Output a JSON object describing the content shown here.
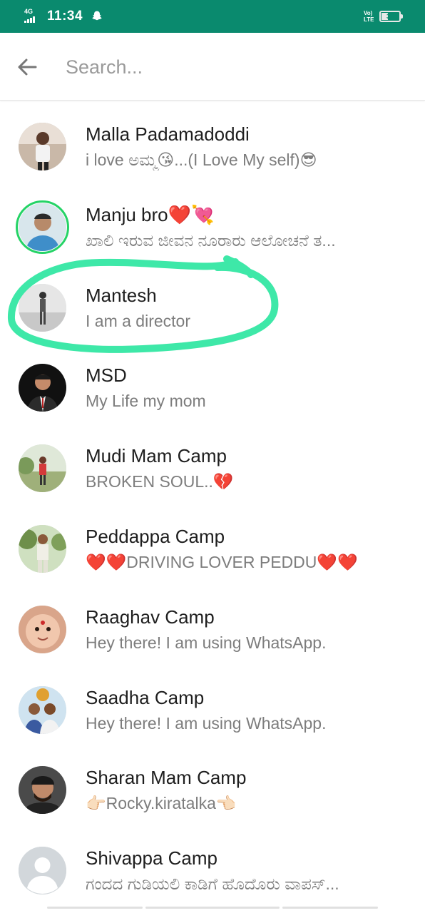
{
  "status_bar": {
    "network": "4G",
    "time": "11:34",
    "volte": "VoLTE",
    "battery_level": "37",
    "icons": [
      "signal-icon",
      "snapchat-icon",
      "volte-icon",
      "battery-icon"
    ]
  },
  "search": {
    "placeholder": "Search...",
    "value": ""
  },
  "contacts": [
    {
      "name": "Malla Padamadoddi",
      "status": "i love ಅಮ್ಮ😘...(I Love My self)😎",
      "avatar": "photo-child"
    },
    {
      "name": "Manju bro❤️💘",
      "status": "ಖಾಲಿ ಇರುವ ಜೀವನ ನೂರಾರು ಆಲೋಚನೆ ತ...",
      "avatar": "photo-man-blue",
      "has_story": true
    },
    {
      "name": "Mantesh",
      "status": "I am  a director",
      "avatar": "photo-bw"
    },
    {
      "name": "MSD",
      "status": "My Life my mom",
      "avatar": "photo-suit"
    },
    {
      "name": "Mudi Mam Camp",
      "status": "BROKEN SOUL..💔",
      "avatar": "photo-field"
    },
    {
      "name": "Peddappa Camp",
      "status": "❤️❤️DRIVING LOVER PEDDU❤️❤️",
      "avatar": "photo-uniform"
    },
    {
      "name": "Raaghav Camp",
      "status": "Hey there! I am using WhatsApp.",
      "avatar": "photo-baby"
    },
    {
      "name": "Saadha Camp",
      "status": "Hey there! I am using WhatsApp.",
      "avatar": "photo-group"
    },
    {
      "name": "Sharan Mam Camp",
      "status": "👉🏻Rocky.kiratalka👈🏻",
      "avatar": "photo-beard"
    },
    {
      "name": "Shivappa Camp",
      "status": "ಗಂದದ ಗುಡಿಯಲಿ ಕಾಡಿಗೆ ಹೊದೊರು ವಾಪಸ್...",
      "avatar": "default-avatar-icon"
    }
  ],
  "colors": {
    "accent": "#0a8a6e",
    "highlight": "#3ee8a8",
    "story_ring": "#25d366"
  }
}
